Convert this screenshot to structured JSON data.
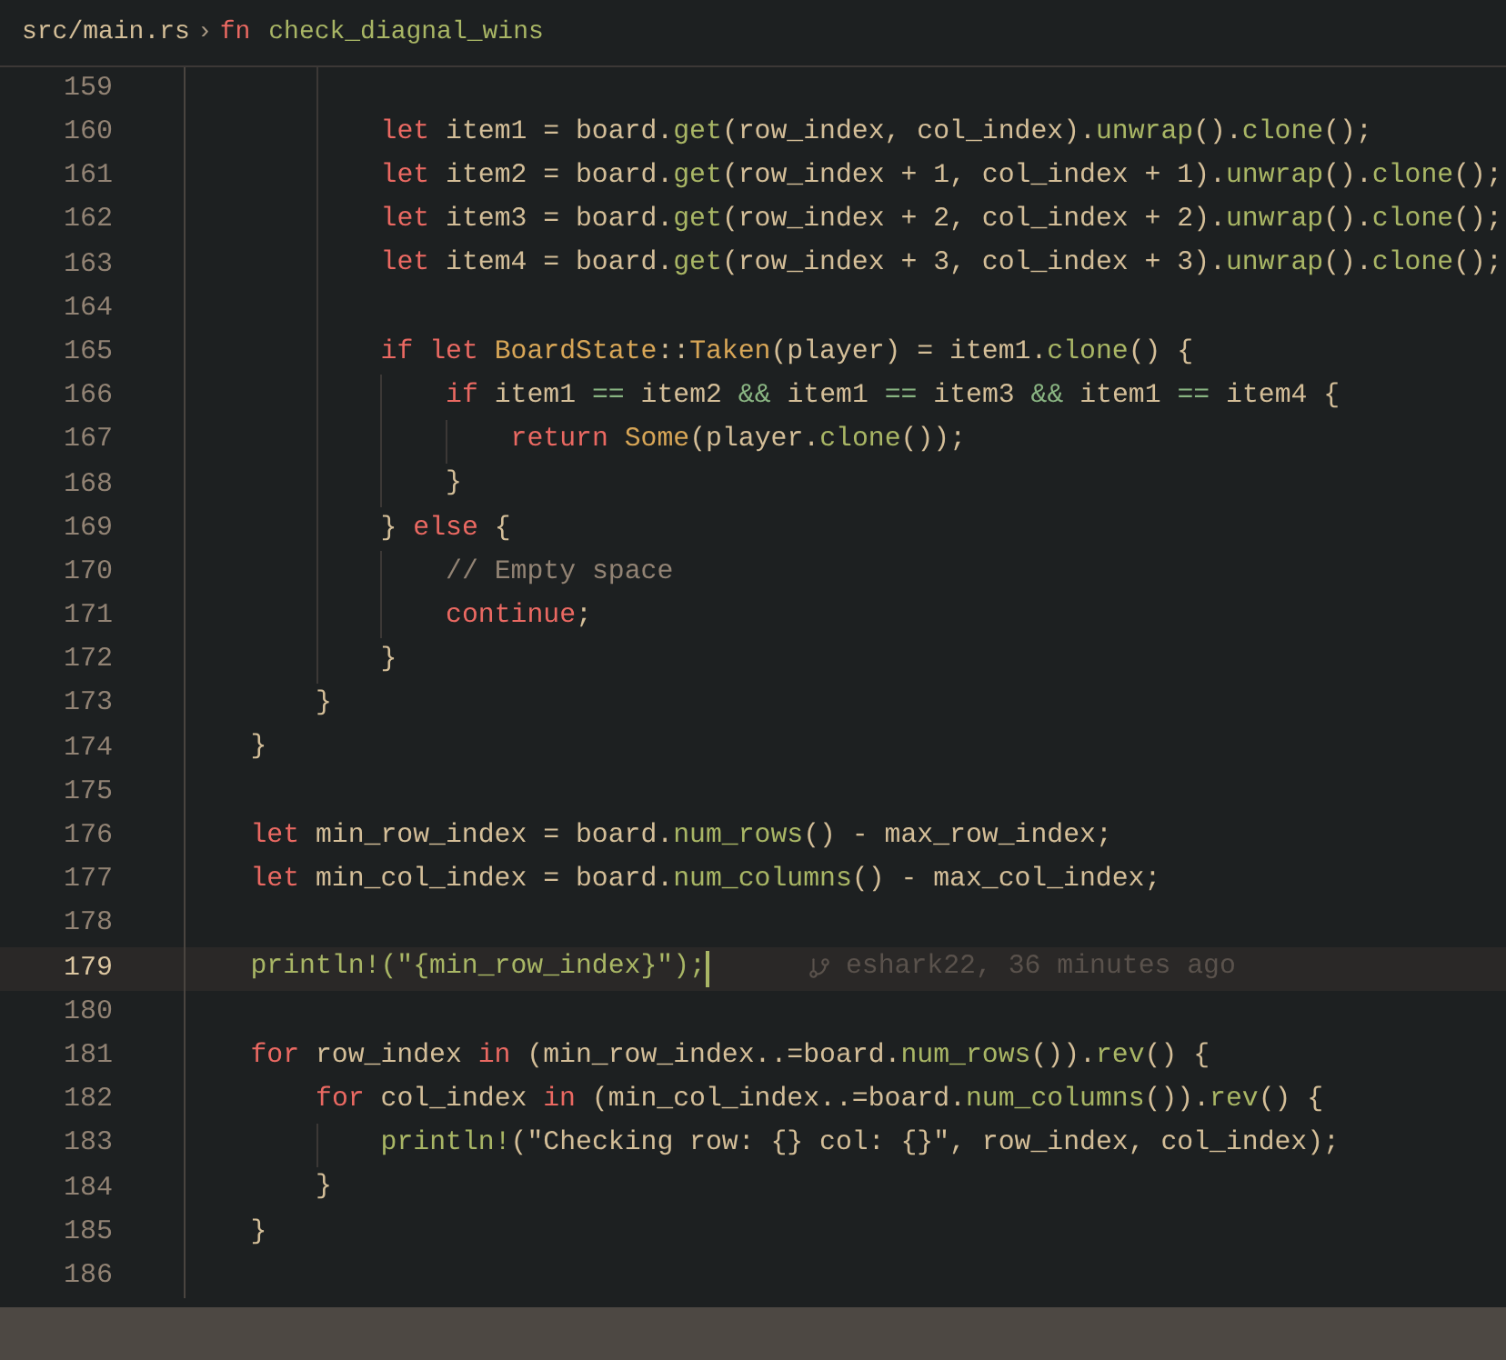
{
  "breadcrumb": {
    "file": "src/main.rs",
    "separator": "›",
    "keyword": "fn",
    "symbol": "check_diagnal_wins"
  },
  "lines": [
    {
      "children": [
        {
          "children": [
            {
              "number": "159",
              "current": false
            },
            {
              "number": "160",
              "current": false,
              "tokens": [
                {
                  "text": "let",
                  "kind": "kw"
                },
                {
                  "text": " item1 = board.",
                  "kind": "pl"
                },
                {
                  "text": "get",
                  "kind": "fn"
                },
                {
                  "text": "(row_index, col_index).",
                  "kind": "pl"
                },
                {
                  "text": "unwrap",
                  "kind": "fn"
                },
                {
                  "text": "().",
                  "kind": "pl"
                },
                {
                  "text": "clone",
                  "kind": "fn"
                },
                {
                  "text": "();",
                  "kind": "pl"
                }
              ]
            },
            {
              "number": "161",
              "current": false,
              "tokens": [
                {
                  "text": "let",
                  "kind": "kw"
                },
                {
                  "text": " item2 = board.",
                  "kind": "pl"
                },
                {
                  "text": "get",
                  "kind": "fn"
                },
                {
                  "text": "(row_index + 1, col_index + 1).",
                  "kind": "pl"
                },
                {
                  "text": "unwrap",
                  "kind": "fn"
                },
                {
                  "text": "().",
                  "kind": "pl"
                },
                {
                  "text": "clone",
                  "kind": "fn"
                },
                {
                  "text": "();",
                  "kind": "pl"
                }
              ]
            },
            {
              "number": "162",
              "current": false,
              "tokens": [
                {
                  "text": "let",
                  "kind": "kw"
                },
                {
                  "text": " item3 = board.",
                  "kind": "pl"
                },
                {
                  "text": "get",
                  "kind": "fn"
                },
                {
                  "text": "(row_index + 2, col_index + 2).",
                  "kind": "pl"
                },
                {
                  "text": "unwrap",
                  "kind": "fn"
                },
                {
                  "text": "().",
                  "kind": "pl"
                },
                {
                  "text": "clone",
                  "kind": "fn"
                },
                {
                  "text": "();",
                  "kind": "pl"
                }
              ]
            },
            {
              "number": "163",
              "current": false,
              "tokens": [
                {
                  "text": "let",
                  "kind": "kw"
                },
                {
                  "text": " item4 = board.",
                  "kind": "pl"
                },
                {
                  "text": "get",
                  "kind": "fn"
                },
                {
                  "text": "(row_index + 3, col_index + 3).",
                  "kind": "pl"
                },
                {
                  "text": "unwrap",
                  "kind": "fn"
                },
                {
                  "text": "().",
                  "kind": "pl"
                },
                {
                  "text": "clone",
                  "kind": "fn"
                },
                {
                  "text": "();",
                  "kind": "pl"
                }
              ]
            },
            {
              "number": "164",
              "current": false
            },
            {
              "number": "165",
              "current": false,
              "tokens": [
                {
                  "text": "if let ",
                  "kind": "kw"
                },
                {
                  "text": "BoardState",
                  "kind": "ty"
                },
                {
                  "text": "::",
                  "kind": "pl"
                },
                {
                  "text": "Taken",
                  "kind": "ty"
                },
                {
                  "text": "(player) = item1.",
                  "kind": "pl"
                },
                {
                  "text": "clone",
                  "kind": "fn"
                },
                {
                  "text": "() {",
                  "kind": "pl"
                }
              ]
            },
            {
              "children": [
                {
                  "number": "166",
                  "current": false,
                  "tokens": [
                    {
                      "text": "if",
                      "kind": "kw"
                    },
                    {
                      "text": " item1 ",
                      "kind": "pl"
                    },
                    {
                      "text": "==",
                      "kind": "op"
                    },
                    {
                      "text": " item2 ",
                      "kind": "pl"
                    },
                    {
                      "text": "&&",
                      "kind": "op"
                    },
                    {
                      "text": " item1 ",
                      "kind": "pl"
                    },
                    {
                      "text": "==",
                      "kind": "op"
                    },
                    {
                      "text": " item3 ",
                      "kind": "pl"
                    },
                    {
                      "text": "&&",
                      "kind": "op"
                    },
                    {
                      "text": " item1 ",
                      "kind": "pl"
                    },
                    {
                      "text": "==",
                      "kind": "op"
                    },
                    {
                      "text": " item4 {",
                      "kind": "pl"
                    }
                  ]
                },
                {
                  "children": [
                    {
                      "number": "167",
                      "current": false,
                      "tokens": [
                        {
                          "text": "return ",
                          "kind": "kw"
                        },
                        {
                          "text": "Some",
                          "kind": "ty"
                        },
                        {
                          "text": "(player.",
                          "kind": "pl"
                        },
                        {
                          "text": "clone",
                          "kind": "fn"
                        },
                        {
                          "text": "());",
                          "kind": "pl"
                        }
                      ]
                    }
                  ]
                },
                {
                  "number": "168",
                  "current": false,
                  "tokens": [
                    {
                      "text": "}",
                      "kind": "pl"
                    }
                  ]
                }
              ]
            },
            {
              "number": "169",
              "current": false,
              "tokens": [
                {
                  "text": "} ",
                  "kind": "pl"
                },
                {
                  "text": "else",
                  "kind": "kw"
                },
                {
                  "text": " {",
                  "kind": "pl"
                }
              ]
            },
            {
              "children": [
                {
                  "number": "170",
                  "current": false,
                  "tokens": [
                    {
                      "text": "// Empty space",
                      "kind": "cm"
                    }
                  ]
                },
                {
                  "number": "171",
                  "current": false,
                  "tokens": [
                    {
                      "text": "continue",
                      "kind": "kw"
                    },
                    {
                      "text": ";",
                      "kind": "pl"
                    }
                  ]
                }
              ]
            },
            {
              "number": "172",
              "current": false,
              "tokens": [
                {
                  "text": "}",
                  "kind": "pl"
                }
              ]
            }
          ]
        },
        {
          "number": "173",
          "current": false,
          "tokens": [
            {
              "text": "}",
              "kind": "pl"
            }
          ]
        }
      ]
    },
    {
      "number": "174",
      "current": false,
      "tokens": [
        {
          "text": "}",
          "kind": "pl"
        }
      ]
    },
    {
      "number": "175",
      "current": false
    },
    {
      "number": "176",
      "current": false,
      "tokens": [
        {
          "text": "let",
          "kind": "kw"
        },
        {
          "text": " min_row_index = board.",
          "kind": "pl"
        },
        {
          "text": "num_rows",
          "kind": "fn"
        },
        {
          "text": "() - max_row_index;",
          "kind": "pl"
        }
      ]
    },
    {
      "number": "177",
      "current": false,
      "tokens": [
        {
          "text": "let",
          "kind": "kw"
        },
        {
          "text": " min_col_index = board.",
          "kind": "pl"
        },
        {
          "text": "num_columns",
          "kind": "fn"
        },
        {
          "text": "() - max_col_index;",
          "kind": "pl"
        }
      ]
    },
    {
      "number": "178",
      "current": false
    },
    {
      "number": "179",
      "current": true,
      "blame": "eshark22, 36 minutes ago",
      "tokens": [
        {
          "text": "println!",
          "kind": "fn"
        },
        {
          "text": "(\"{min_row_index}\");",
          "kind": "fn"
        }
      ]
    },
    {
      "number": "180",
      "current": false
    },
    {
      "number": "181",
      "current": false,
      "tokens": [
        {
          "text": "for",
          "kind": "kw"
        },
        {
          "text": " row_index ",
          "kind": "pl"
        },
        {
          "text": "in",
          "kind": "kw"
        },
        {
          "text": " (min_row_index..=board.",
          "kind": "pl"
        },
        {
          "text": "num_rows",
          "kind": "fn"
        },
        {
          "text": "()).",
          "kind": "pl"
        },
        {
          "text": "rev",
          "kind": "fn"
        },
        {
          "text": "() {",
          "kind": "pl"
        }
      ]
    },
    {
      "children": [
        {
          "number": "182",
          "current": false,
          "tokens": [
            {
              "text": "for",
              "kind": "kw"
            },
            {
              "text": " col_index ",
              "kind": "pl"
            },
            {
              "text": "in",
              "kind": "kw"
            },
            {
              "text": " (min_col_index..=board.",
              "kind": "pl"
            },
            {
              "text": "num_columns",
              "kind": "fn"
            },
            {
              "text": "()).",
              "kind": "pl"
            },
            {
              "text": "rev",
              "kind": "fn"
            },
            {
              "text": "() {",
              "kind": "pl"
            }
          ]
        },
        {
          "children": [
            {
              "number": "183",
              "current": false,
              "tokens": [
                {
                  "text": "println!",
                  "kind": "fn"
                },
                {
                  "text": "(\"Checking row: {} col: {}\", row_index, col_index);",
                  "kind": "pl"
                }
              ]
            }
          ]
        },
        {
          "number": "184",
          "current": false,
          "tokens": [
            {
              "text": "}",
              "kind": "pl"
            }
          ]
        }
      ]
    },
    {
      "number": "185",
      "current": false,
      "tokens": [
        {
          "text": "}",
          "kind": "pl"
        }
      ]
    },
    {
      "number": "186",
      "current": false
    }
  ]
}
